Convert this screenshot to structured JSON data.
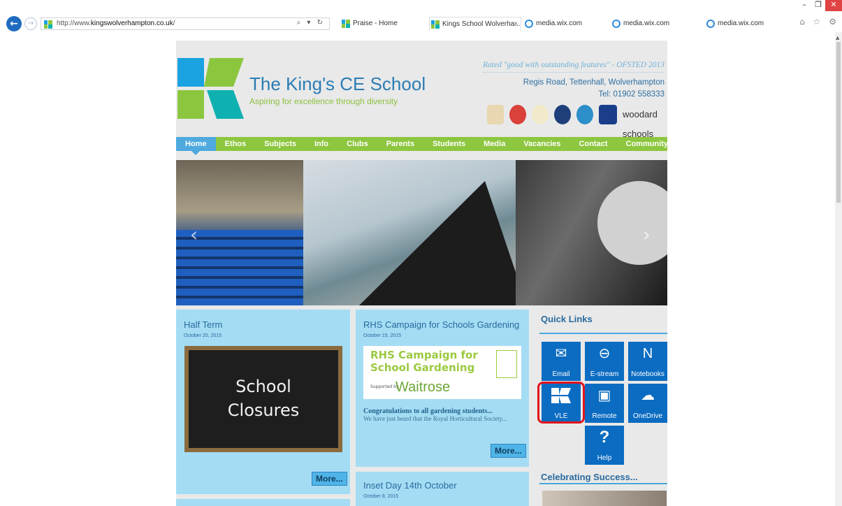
{
  "browser": {
    "url_prefix": "http://www.",
    "url_domain": "kingswolverhampton.co.uk",
    "url_suffix": "/",
    "search_tools": "⌕ ▾ ↻",
    "tabs": [
      {
        "label": "Praise - Home",
        "active": false
      },
      {
        "label": "Kings School Wolverha...",
        "active": true
      },
      {
        "label": "media.wix.com",
        "active": false
      },
      {
        "label": "media.wix.com",
        "active": false
      },
      {
        "label": "media.wix.com",
        "active": false
      }
    ],
    "right_icons": "⌂ ☆ ⚙"
  },
  "site": {
    "title": "The King's CE School",
    "tagline": "Aspiring for excellence through diversity",
    "rated": "Rated \"good with outstanding features\" - OFSTED 2013",
    "address": "Regis Road, Tettenhall, Wolverhampton",
    "tel": "Tel: 01902 558333",
    "woodard": "woodard schools"
  },
  "nav": [
    {
      "label": "Home",
      "active": true
    },
    {
      "label": "Ethos"
    },
    {
      "label": "Subjects"
    },
    {
      "label": "Info"
    },
    {
      "label": "Clubs"
    },
    {
      "label": "Parents"
    },
    {
      "label": "Students"
    },
    {
      "label": "Media"
    },
    {
      "label": "Vacancies"
    },
    {
      "label": "Contact"
    },
    {
      "label": "Community"
    }
  ],
  "hero": {
    "prev": "‹",
    "next": "›"
  },
  "news": [
    {
      "title": "Half Term",
      "date": "October 20, 2015",
      "image_text_1": "School",
      "image_text_2": "Closures",
      "more": "More..."
    },
    {
      "title": "RHS Campaign for Schools Gardening",
      "date": "October 15, 2015",
      "image_line_1": "RHS Campaign for",
      "image_line_2": "School Gardening",
      "image_supported": "Supported by",
      "image_brand": "Waitrose",
      "headline": "Congratulations to all gardening students...",
      "excerpt": "We have just heard that the Royal Horticultural Society...",
      "more": "More..."
    },
    {
      "title": "Inset Day 14th October",
      "date": "October 8, 2015"
    }
  ],
  "quick_links": {
    "title": "Quick Links",
    "tiles": [
      {
        "label": "Email",
        "icon": "outlook-icon"
      },
      {
        "label": "E-stream",
        "icon": "estream-icon"
      },
      {
        "label": "Notebooks",
        "icon": "onenote-icon"
      },
      {
        "label": "VLE",
        "icon": "vle-icon"
      },
      {
        "label": "Remote",
        "icon": "remote-icon"
      },
      {
        "label": "OneDrive",
        "icon": "onedrive-icon"
      },
      {
        "label": "Help",
        "icon": "help-icon"
      }
    ]
  },
  "celebrating": {
    "title": "Celebrating Success..."
  }
}
